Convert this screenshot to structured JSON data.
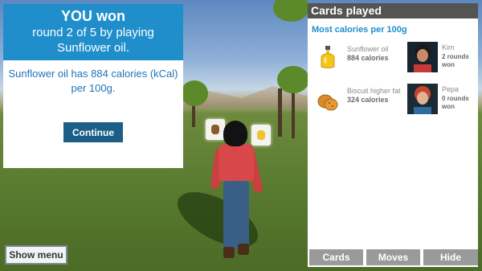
{
  "result_panel": {
    "title": "YOU won",
    "line1": "round 2 of 5 by playing",
    "line2": "Sunflower oil.",
    "message": "Sunflower oil has 884 calories (kCal) per 100g.",
    "continue_label": "Continue"
  },
  "show_menu_label": "Show menu",
  "cards_panel": {
    "title": "Cards played",
    "subtitle": "Most calories per 100g",
    "rows": [
      {
        "card_name": "Sunflower oil",
        "calories": "884 calories",
        "player": "Kim",
        "rounds_line1": "2 rounds",
        "rounds_line2": "won",
        "icon": "oil-bottle-icon"
      },
      {
        "card_name": "Biscuit higher fat",
        "calories": "324 calories",
        "player": "Pepa",
        "rounds_line1": "0 rounds",
        "rounds_line2": "won",
        "icon": "biscuit-icon"
      }
    ],
    "buttons": {
      "cards": "Cards",
      "moves": "Moves",
      "hide": "Hide"
    }
  },
  "colors": {
    "accent": "#1f8ecb",
    "continue": "#1b5f86",
    "header_dark": "#545454",
    "bottom_button": "#9a9a9a"
  }
}
